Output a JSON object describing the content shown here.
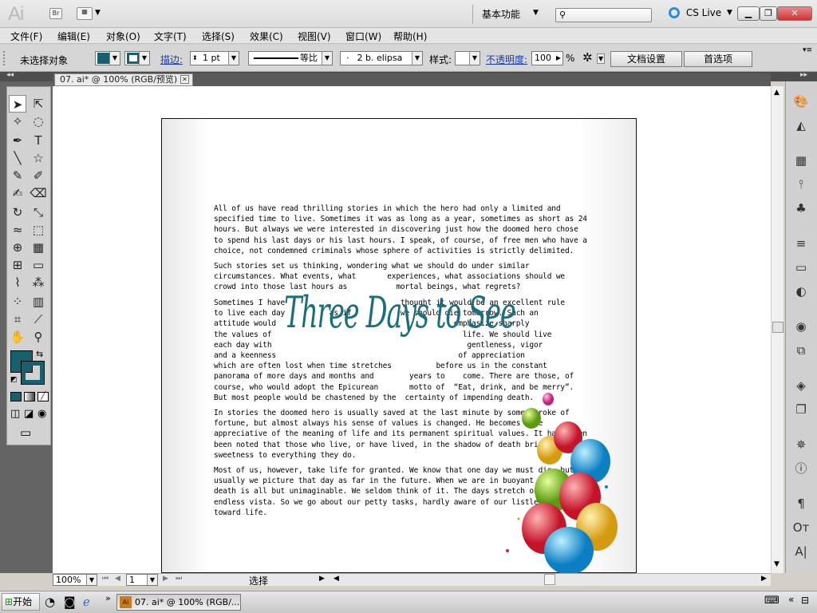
{
  "app": {
    "logo": "Ai",
    "bridge": "Br",
    "workspace": "基本功能",
    "cslive": "CS Live"
  },
  "menu": [
    "文件(F)",
    "编辑(E)",
    "对象(O)",
    "文字(T)",
    "选择(S)",
    "效果(C)",
    "视图(V)",
    "窗口(W)",
    "帮助(H)"
  ],
  "control": {
    "no_selection": "未选择对象",
    "stroke_label": "描边:",
    "stroke_value": "1 pt",
    "profile": "等比",
    "brush": "2 b. elipsa",
    "style_label": "样式:",
    "opacity_label": "不透明度:",
    "opacity_value": "100",
    "opacity_unit": "%",
    "doc_setup": "文档设置",
    "preferences": "首选项"
  },
  "colors": {
    "fill": "#17606e",
    "accent": "#1c6f7a"
  },
  "document": {
    "tab": "07. ai* @ 100% (RGB/预览)",
    "title_art": "Three Days to See",
    "p1": "All of us have read thrilling stories in which the hero had only a limited and\nspecified time to live. Sometimes it was as long as a year, sometimes as short as 24\nhours. But always we were interested in discovering just how the doomed hero chose\nto spend his last days or his last hours. I speak, of course, of free men who have a\nchoice, not condemned criminals whose sphere of activities is strictly delimited.",
    "p2": "Such stories set us thinking, wondering what we should do under similar\ncircumstances. What events, what       experiences, what associations should we\ncrowd into those last hours as           mortal beings, what regrets?",
    "p3": "Sometimes I have                          thought it would be an excellent rule\nto live each day          as if           we should die tomorrow. Such an\nattitude would                                        emphasize sharply\nthe values of                                           life. We should live\neach day with                                            gentleness, vigor\nand a keenness                                         of appreciation\nwhich are often lost when time stretches          before us in the constant\npanorama of more days and months and        years to    come. There are those, of\ncourse, who would adopt the Epicurean       motto of  “Eat, drink, and be merry”.\nBut most people would be chastened by the  certainty of impending death.",
    "p4": "In stories the doomed hero is usually saved at the last minute by some stroke of\nfortune, but almost always his sense of values is changed. He becomes more\nappreciative of the meaning of life and its permanent spiritual values. It has often\nbeen noted that those who live, or have lived, in the shadow of death bring a mellow\nsweetness to everything they do.",
    "p5": "Most of us, however, take life for granted. We know that one day we must die, but\nusually we picture that day as far in the future. When we are in buoyant health,\ndeath is all but unimaginable. We seldom think of it. The days stretch out in an\nendless vista. So we go about our petty tasks, hardly aware of our listless attitude\ntoward life."
  },
  "status": {
    "zoom": "100%",
    "page": "1",
    "mode": "选择"
  },
  "taskbar": {
    "start": "开始",
    "task": "07. ai* @ 100% (RGB/..."
  }
}
